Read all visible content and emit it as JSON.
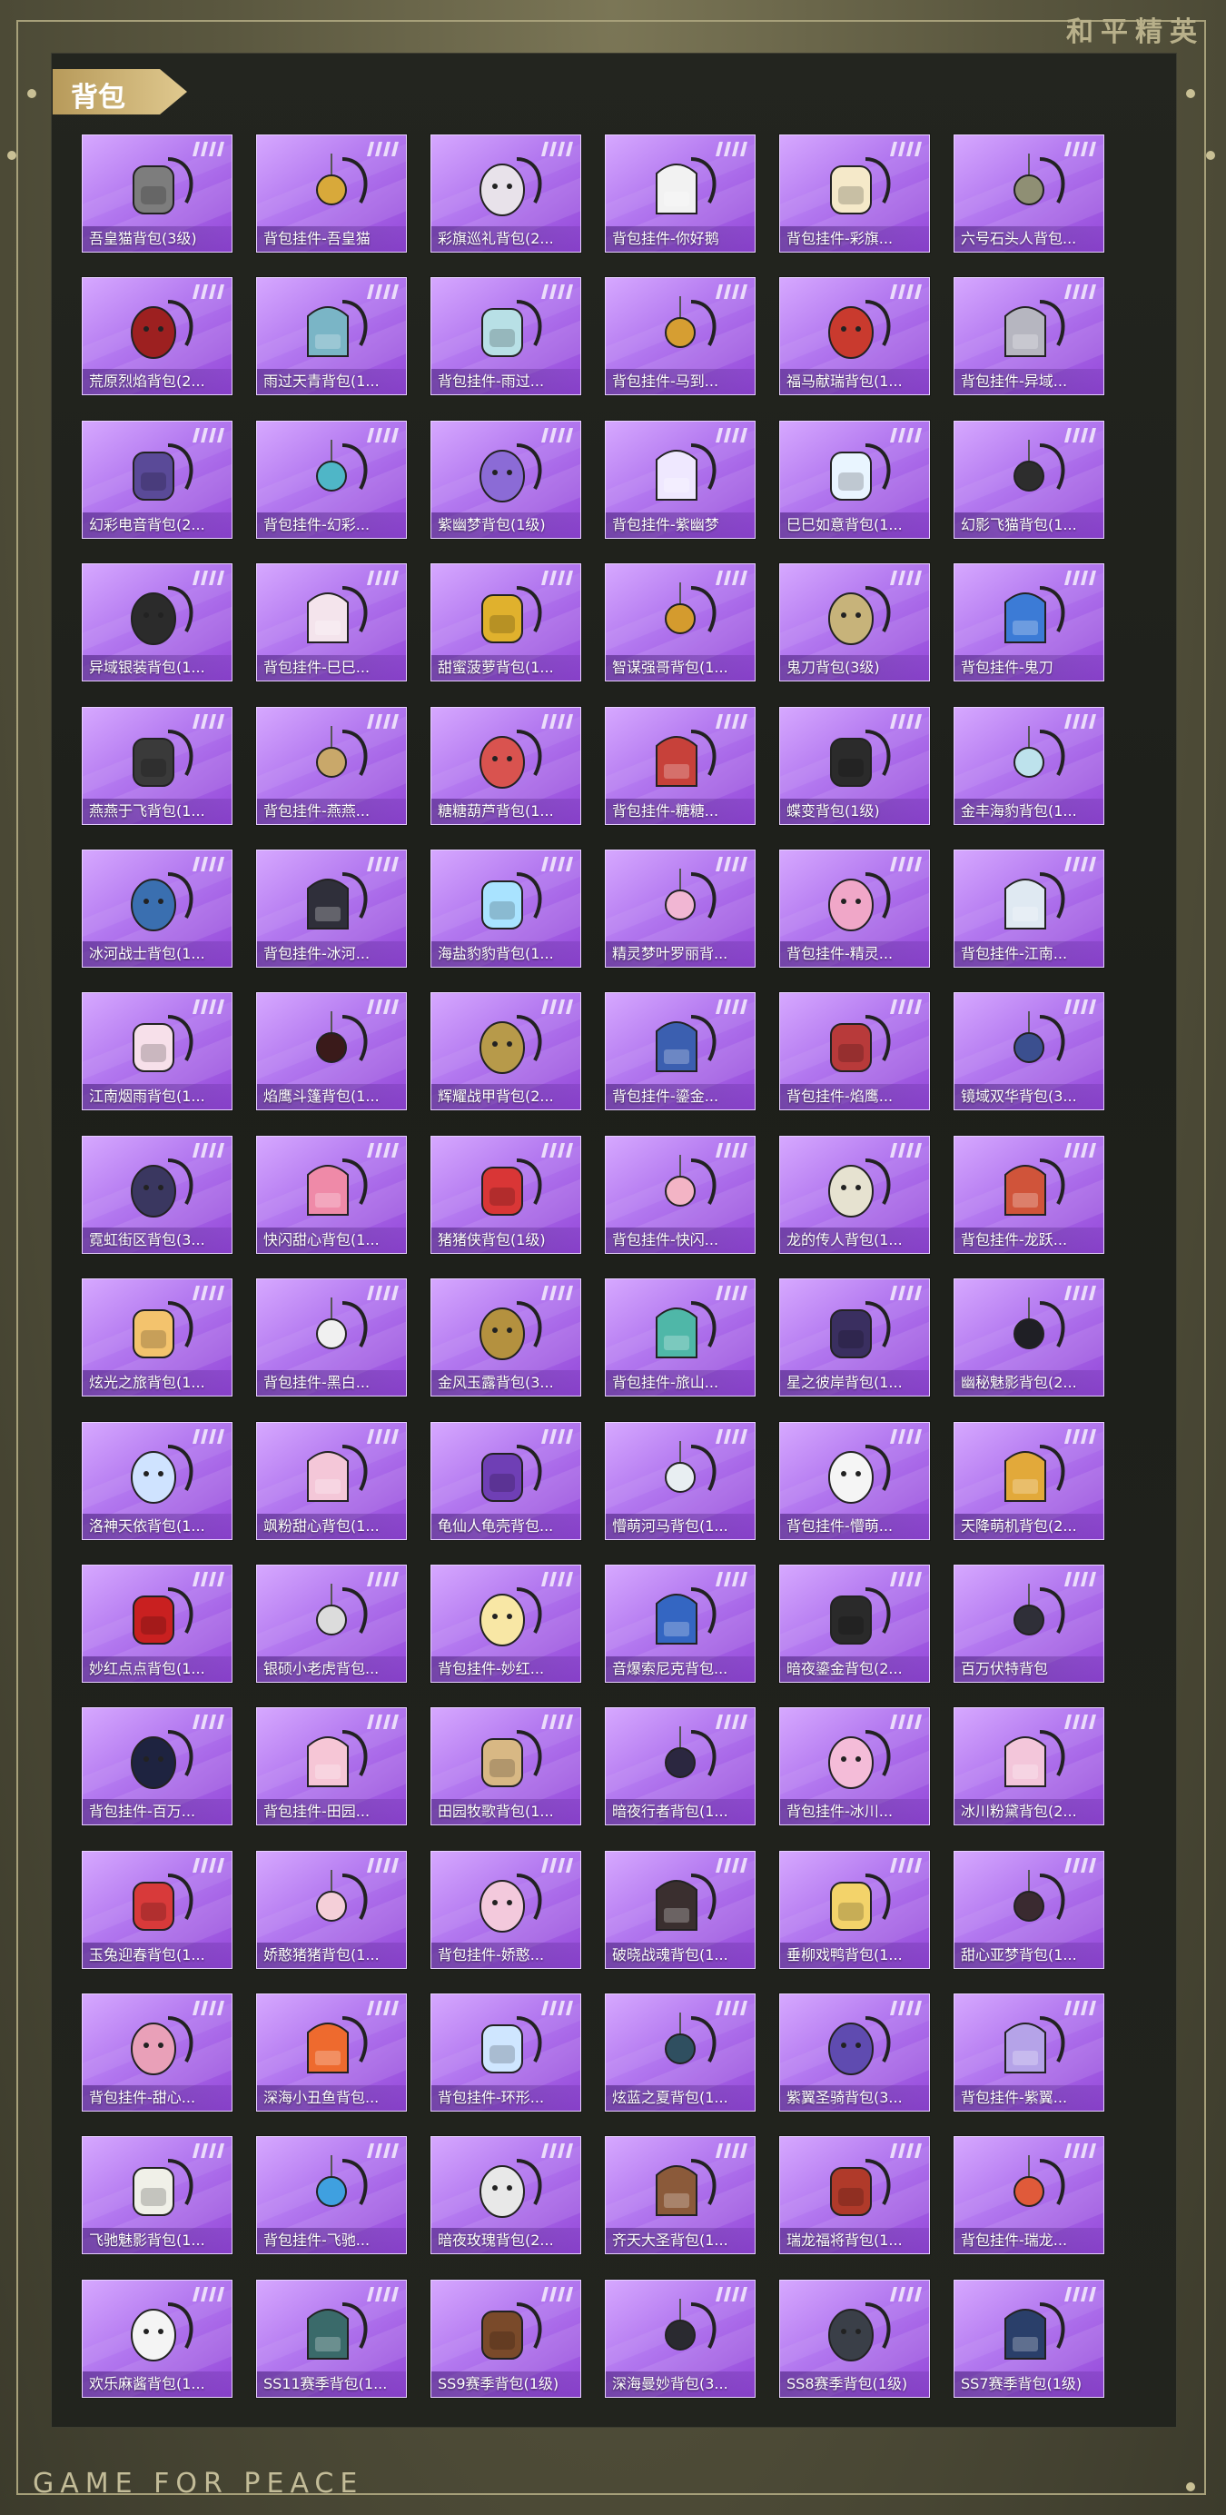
{
  "brand": "和平精英",
  "footer_brand": "GAME FOR PEACE",
  "section_title": "背包",
  "items": [
    {
      "name": "吾皇猫背包(3级)",
      "color": "#7d7d7d"
    },
    {
      "name": "背包挂件-吾皇猫",
      "color": "#d8a93a"
    },
    {
      "name": "彩旗巡礼背包(2...",
      "color": "#e8e2ea"
    },
    {
      "name": "背包挂件-你好鹅",
      "color": "#f2f2f2"
    },
    {
      "name": "背包挂件-彩旗...",
      "color": "#f5e9c9"
    },
    {
      "name": "六号石头人背包...",
      "color": "#8f8f74"
    },
    {
      "name": "荒原烈焰背包(2...",
      "color": "#9d2020"
    },
    {
      "name": "雨过天青背包(1...",
      "color": "#7ab5c6"
    },
    {
      "name": "背包挂件-雨过...",
      "color": "#b8e0e6"
    },
    {
      "name": "背包挂件-马到...",
      "color": "#d69e32"
    },
    {
      "name": "福马献瑞背包(1...",
      "color": "#c93a2e"
    },
    {
      "name": "背包挂件-异域...",
      "color": "#b6b6c0"
    },
    {
      "name": "幻彩电音背包(2...",
      "color": "#5a4a98"
    },
    {
      "name": "背包挂件-幻彩...",
      "color": "#4fb6c7"
    },
    {
      "name": "紫幽梦背包(1级)",
      "color": "#8b6bd6"
    },
    {
      "name": "背包挂件-紫幽梦",
      "color": "#efe8ff"
    },
    {
      "name": "巳巳如意背包(1...",
      "color": "#e9f5ff"
    },
    {
      "name": "幻影飞猫背包(1...",
      "color": "#2d2d2d"
    },
    {
      "name": "异域银装背包(1...",
      "color": "#2b2b2b"
    },
    {
      "name": "背包挂件-巳巳...",
      "color": "#f4e4ec"
    },
    {
      "name": "甜蜜菠萝背包(1...",
      "color": "#e0b12d"
    },
    {
      "name": "智谋强哥背包(1...",
      "color": "#d49b2e"
    },
    {
      "name": "鬼刀背包(3级)",
      "color": "#c7b37a"
    },
    {
      "name": "背包挂件-鬼刀",
      "color": "#3c7bd6"
    },
    {
      "name": "燕燕于飞背包(1...",
      "color": "#3a3a3a"
    },
    {
      "name": "背包挂件-燕燕...",
      "color": "#c9a86a"
    },
    {
      "name": "糖糖葫芦背包(1...",
      "color": "#d9534f"
    },
    {
      "name": "背包挂件-糖糖...",
      "color": "#c7413a"
    },
    {
      "name": "蝶变背包(1级)",
      "color": "#2b2b2b"
    },
    {
      "name": "金丰海豹背包(1...",
      "color": "#bde2ec"
    },
    {
      "name": "冰河战士背包(1...",
      "color": "#3a6fb0"
    },
    {
      "name": "背包挂件-冰河...",
      "color": "#2f2f3a"
    },
    {
      "name": "海盐豹豹背包(1...",
      "color": "#a9e3ff"
    },
    {
      "name": "精灵梦叶罗丽背...",
      "color": "#f1b6d3"
    },
    {
      "name": "背包挂件-精灵...",
      "color": "#f0a7c8"
    },
    {
      "name": "背包挂件-江南...",
      "color": "#dfe9f2"
    },
    {
      "name": "江南烟雨背包(1...",
      "color": "#f7e0ea"
    },
    {
      "name": "焰鹰斗篷背包(1...",
      "color": "#3a1a1a"
    },
    {
      "name": "辉耀战甲背包(2...",
      "color": "#b79a4a"
    },
    {
      "name": "背包挂件-鎏金...",
      "color": "#3b5fb0"
    },
    {
      "name": "背包挂件-焰鹰...",
      "color": "#b83a3a"
    },
    {
      "name": "镜域双华背包(3...",
      "color": "#3b4f8f"
    },
    {
      "name": "霓虹街区背包(3...",
      "color": "#3a3760"
    },
    {
      "name": "快闪甜心背包(1...",
      "color": "#ef8aa8"
    },
    {
      "name": "猪猪侠背包(1级)",
      "color": "#d93636"
    },
    {
      "name": "背包挂件-快闪...",
      "color": "#f3b4c5"
    },
    {
      "name": "龙的传人背包(1...",
      "color": "#e6e2d0"
    },
    {
      "name": "背包挂件-龙跃...",
      "color": "#d0543a"
    },
    {
      "name": "炫光之旅背包(1...",
      "color": "#f3c36d"
    },
    {
      "name": "背包挂件-黑白...",
      "color": "#f0f0f0"
    },
    {
      "name": "金风玉露背包(3...",
      "color": "#b4913f"
    },
    {
      "name": "背包挂件-旅山...",
      "color": "#4fb7a8"
    },
    {
      "name": "星之彼岸背包(1...",
      "color": "#3a2f60"
    },
    {
      "name": "幽秘魅影背包(2...",
      "color": "#1f1f25"
    },
    {
      "name": "洛神天依背包(1...",
      "color": "#cfe3ff"
    },
    {
      "name": "飒粉甜心背包(1...",
      "color": "#f4c7d8"
    },
    {
      "name": "龟仙人龟壳背包...",
      "color": "#6f3fb5"
    },
    {
      "name": "懵萌河马背包(1...",
      "color": "#e8eef2"
    },
    {
      "name": "背包挂件-懵萌...",
      "color": "#f5f5f5"
    },
    {
      "name": "天降萌机背包(2...",
      "color": "#e2a93a"
    },
    {
      "name": "妙红点点背包(1...",
      "color": "#c92020"
    },
    {
      "name": "银硕小老虎背包...",
      "color": "#dcdcdc"
    },
    {
      "name": "背包挂件-妙红...",
      "color": "#f8e7a5"
    },
    {
      "name": "音爆索尼克背包...",
      "color": "#3466c2"
    },
    {
      "name": "暗夜鎏金背包(2...",
      "color": "#2a2a2a"
    },
    {
      "name": "百万伏特背包",
      "color": "#2f2f38"
    },
    {
      "name": "背包挂件-百万...",
      "color": "#1e2340"
    },
    {
      "name": "背包挂件-田园...",
      "color": "#f6c6d6"
    },
    {
      "name": "田园牧歌背包(1...",
      "color": "#d8b884"
    },
    {
      "name": "暗夜行者背包(1...",
      "color": "#2b2740"
    },
    {
      "name": "背包挂件-冰川...",
      "color": "#f4bcd8"
    },
    {
      "name": "冰川粉黛背包(2...",
      "color": "#f3c6da"
    },
    {
      "name": "玉兔迎春背包(1...",
      "color": "#d83a3a"
    },
    {
      "name": "娇憨猪猪背包(1...",
      "color": "#f4cfd8"
    },
    {
      "name": "背包挂件-娇憨...",
      "color": "#f3c9dc"
    },
    {
      "name": "破晓战魂背包(1...",
      "color": "#3a2f2f"
    },
    {
      "name": "垂柳戏鸭背包(1...",
      "color": "#f3d36a"
    },
    {
      "name": "甜心亚梦背包(1...",
      "color": "#3a2a30"
    },
    {
      "name": "背包挂件-甜心...",
      "color": "#e9a0b8"
    },
    {
      "name": "深海小丑鱼背包...",
      "color": "#ee6a2e"
    },
    {
      "name": "背包挂件-环形...",
      "color": "#cfe6ff"
    },
    {
      "name": "炫蓝之夏背包(1...",
      "color": "#2f4f60"
    },
    {
      "name": "紫翼圣骑背包(3...",
      "color": "#5f4bb0"
    },
    {
      "name": "背包挂件-紫翼...",
      "color": "#b5a3e8"
    },
    {
      "name": "飞驰魅影背包(1...",
      "color": "#f0f0e8"
    },
    {
      "name": "背包挂件-飞驰...",
      "color": "#3fa0e0"
    },
    {
      "name": "暗夜玫瑰背包(2...",
      "color": "#e8e8e8"
    },
    {
      "name": "齐天大圣背包(1...",
      "color": "#8b5a3a"
    },
    {
      "name": "瑞龙福将背包(1...",
      "color": "#b03a2a"
    },
    {
      "name": "背包挂件-瑞龙...",
      "color": "#e05a3a"
    },
    {
      "name": "欢乐麻酱背包(1...",
      "color": "#f4f4f4"
    },
    {
      "name": "SS11赛季背包(1...",
      "color": "#3a6a6a"
    },
    {
      "name": "SS9赛季背包(1级)",
      "color": "#7a4a2a"
    },
    {
      "name": "深海曼妙背包(3...",
      "color": "#2a2a30"
    },
    {
      "name": "SS8赛季背包(1级)",
      "color": "#3a3f48"
    },
    {
      "name": "SS7赛季背包(1级)",
      "color": "#2a3f6a"
    }
  ]
}
